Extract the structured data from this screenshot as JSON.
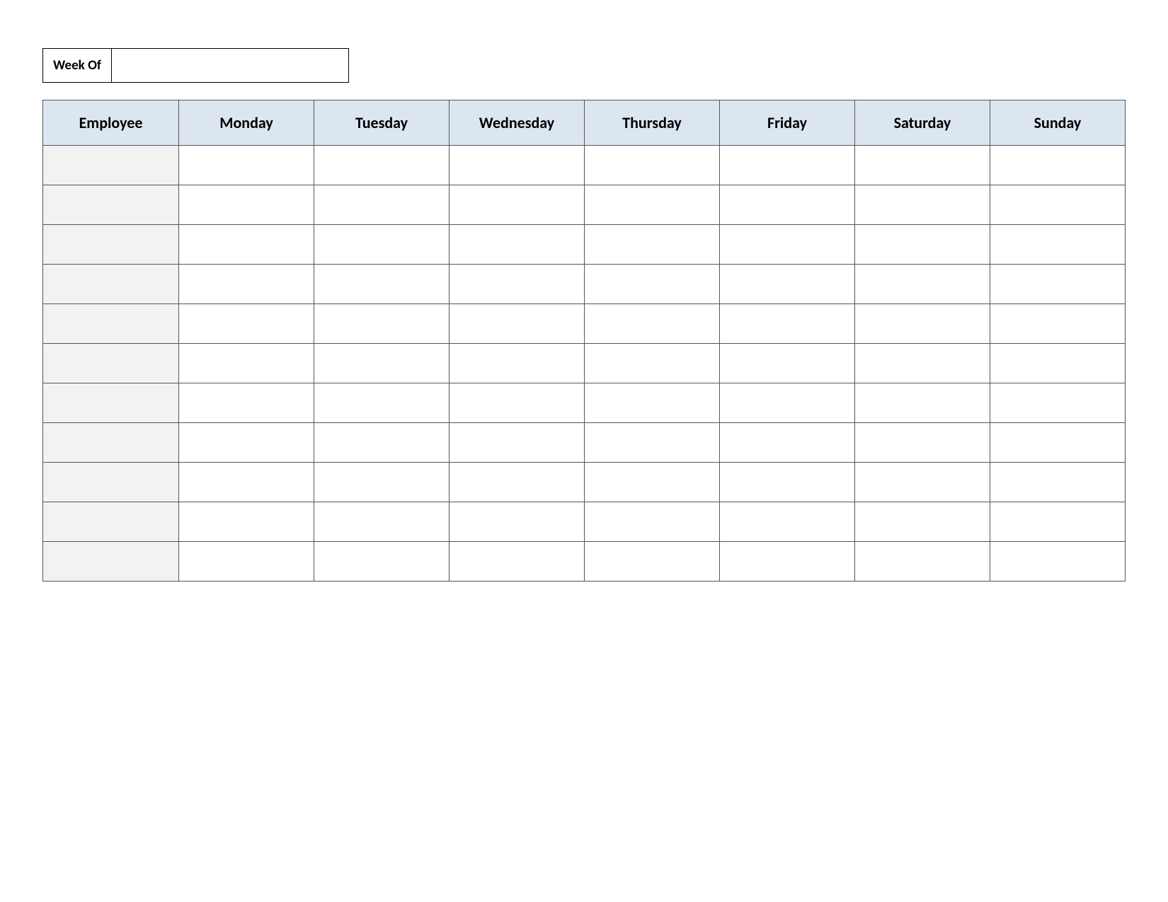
{
  "week_of": {
    "label": "Week Of",
    "value": ""
  },
  "table": {
    "headers": [
      "Employee",
      "Monday",
      "Tuesday",
      "Wednesday",
      "Thursday",
      "Friday",
      "Saturday",
      "Sunday"
    ],
    "rows": [
      {
        "employee": "",
        "monday": "",
        "tuesday": "",
        "wednesday": "",
        "thursday": "",
        "friday": "",
        "saturday": "",
        "sunday": ""
      },
      {
        "employee": "",
        "monday": "",
        "tuesday": "",
        "wednesday": "",
        "thursday": "",
        "friday": "",
        "saturday": "",
        "sunday": ""
      },
      {
        "employee": "",
        "monday": "",
        "tuesday": "",
        "wednesday": "",
        "thursday": "",
        "friday": "",
        "saturday": "",
        "sunday": ""
      },
      {
        "employee": "",
        "monday": "",
        "tuesday": "",
        "wednesday": "",
        "thursday": "",
        "friday": "",
        "saturday": "",
        "sunday": ""
      },
      {
        "employee": "",
        "monday": "",
        "tuesday": "",
        "wednesday": "",
        "thursday": "",
        "friday": "",
        "saturday": "",
        "sunday": ""
      },
      {
        "employee": "",
        "monday": "",
        "tuesday": "",
        "wednesday": "",
        "thursday": "",
        "friday": "",
        "saturday": "",
        "sunday": ""
      },
      {
        "employee": "",
        "monday": "",
        "tuesday": "",
        "wednesday": "",
        "thursday": "",
        "friday": "",
        "saturday": "",
        "sunday": ""
      },
      {
        "employee": "",
        "monday": "",
        "tuesday": "",
        "wednesday": "",
        "thursday": "",
        "friday": "",
        "saturday": "",
        "sunday": ""
      },
      {
        "employee": "",
        "monday": "",
        "tuesday": "",
        "wednesday": "",
        "thursday": "",
        "friday": "",
        "saturday": "",
        "sunday": ""
      },
      {
        "employee": "",
        "monday": "",
        "tuesday": "",
        "wednesday": "",
        "thursday": "",
        "friday": "",
        "saturday": "",
        "sunday": ""
      },
      {
        "employee": "",
        "monday": "",
        "tuesday": "",
        "wednesday": "",
        "thursday": "",
        "friday": "",
        "saturday": "",
        "sunday": ""
      }
    ]
  }
}
